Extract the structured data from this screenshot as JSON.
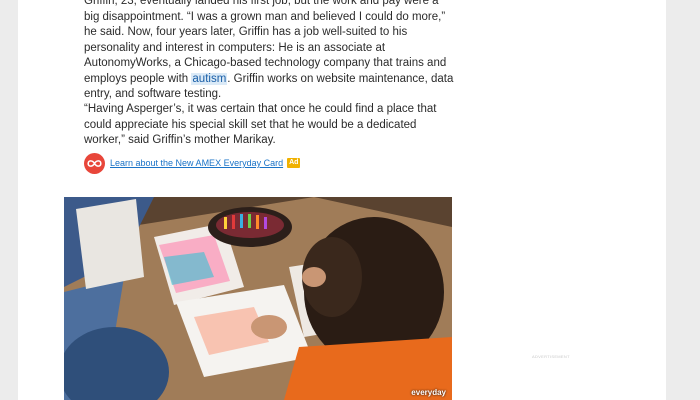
{
  "article": {
    "para1": {
      "before_link": "Griffin, 23, eventually landed his first job, but the work and pay were a big disappointment. “I was a grown man and believed I could do more,” he said. Now, four years later, Griffin has a job well-suited to his personality and interest in computers: He is an associate at AutonomyWorks, a Chicago-based technology company that trains and employs people with ",
      "link_text": "autism",
      "after_link": ". Griffin works on website maintenance, data entry, and software testing."
    },
    "para2": "“Having Asperger’s, it was certain that once he could find a place that could appreciate his special skill set that he would be a dedicated worker,” said Griffin’s mother Marikay."
  },
  "sponsored": {
    "icon": "infinity-icon",
    "link_text": "Learn about the New AMEX Everyday Card",
    "badge": "Ad"
  },
  "video": {
    "watermark": "everyday"
  },
  "sidebar": {
    "ad_label": "ADVERTISEMENT"
  },
  "colors": {
    "page_bg": "#ececec",
    "link": "#1a73c7",
    "keyword_highlight": "#dbeaf7",
    "logo_red": "#e8463a",
    "badge_yellow": "#f0b100"
  }
}
